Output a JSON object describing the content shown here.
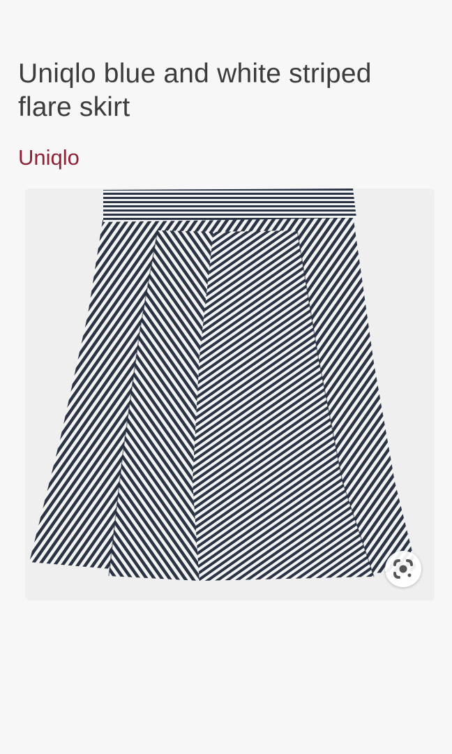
{
  "product": {
    "title": "Uniqlo blue and white striped flare skirt",
    "brand": "Uniqlo"
  },
  "image": {
    "subject": "skirt-photo",
    "colors": {
      "stripe_dark": "#2b3445",
      "stripe_light": "#f4f4f4",
      "background": "#efefef"
    }
  },
  "colors": {
    "brand": "#8c2335",
    "title": "#3c3c3c",
    "page_bg": "#f7f7f7"
  },
  "icons": {
    "visual_search": "lens-icon"
  }
}
